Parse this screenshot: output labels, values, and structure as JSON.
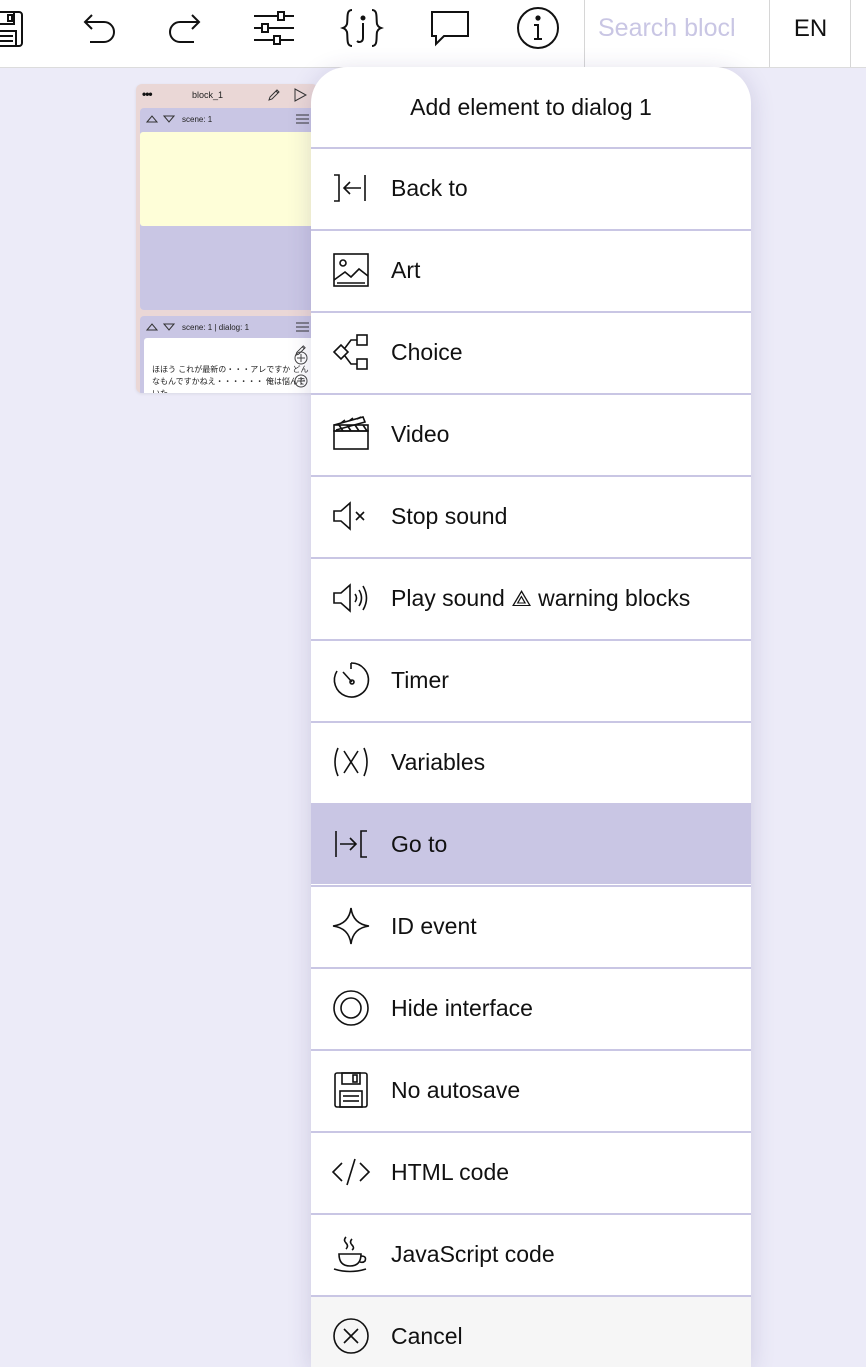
{
  "toolbar": {
    "icons": [
      "save-icon",
      "undo-icon",
      "redo-icon",
      "settings-sliders-icon",
      "json-icon",
      "comment-icon",
      "info-icon"
    ],
    "search_placeholder": "Search blocks",
    "language": "EN"
  },
  "block": {
    "title": "block_1",
    "scene1_label": "scene: 1",
    "scene2_label": "scene: 1 | dialog: 1",
    "dialog_text": "ほほう これが最新の・・・アレですか どんなもんですかねえ・・・・・・ 俺は悩んでいた。"
  },
  "popup": {
    "title": "Add element to dialog 1",
    "items": [
      {
        "label": "Back to",
        "icon": "back-to-icon"
      },
      {
        "label": "Art",
        "icon": "image-icon"
      },
      {
        "label": "Choice",
        "icon": "choice-icon"
      },
      {
        "label": "Video",
        "icon": "clapperboard-icon"
      },
      {
        "label": "Stop sound",
        "icon": "speaker-mute-icon"
      },
      {
        "label": "Play sound ⟁ warning blocks",
        "icon": "speaker-play-icon"
      },
      {
        "label": "Timer",
        "icon": "timer-icon"
      },
      {
        "label": "Variables",
        "icon": "variables-icon"
      },
      {
        "label": "Go to",
        "icon": "go-to-icon",
        "active": true
      },
      {
        "label": "ID event",
        "icon": "sparkle-icon"
      },
      {
        "label": "Hide interface",
        "icon": "circle-target-icon"
      },
      {
        "label": "No autosave",
        "icon": "floppy-disk-icon"
      },
      {
        "label": "HTML code",
        "icon": "code-icon"
      },
      {
        "label": "JavaScript code",
        "icon": "coffee-cup-icon"
      },
      {
        "label": "Cancel",
        "icon": "cancel-icon"
      }
    ]
  },
  "colors": {
    "canvas": "#ecebf8",
    "accent": "#c9c6e4",
    "block_bg": "#ead7d6",
    "note_bg": "#fefed8"
  }
}
